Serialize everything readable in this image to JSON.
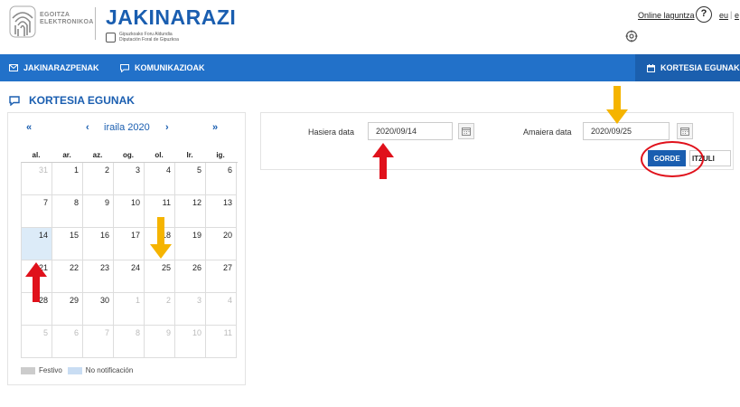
{
  "header": {
    "logo_line1": "EGOITZA",
    "logo_line2": "ELEKTRONIKOA",
    "app_title": "JAKINARAZI",
    "gip_line1": "Gipuzkoako Foru Aldundia",
    "gip_line2": "Diputación Foral de Gipuzkoa",
    "help_link": "Online laguntza",
    "help_icon_label": "?",
    "lang_eu": "eu",
    "lang_sep": "|",
    "lang_es": "e"
  },
  "nav": {
    "items": [
      {
        "label": "Jakinarazpenak",
        "icon": "envelope-icon"
      },
      {
        "label": "Komunikazioak",
        "icon": "comment-icon"
      },
      {
        "label": "Kortesia egunak",
        "icon": "calendar-icon"
      }
    ],
    "active_index": 2,
    "colors": {
      "bar": "#2271c9",
      "active": "#1b5fae"
    }
  },
  "section": {
    "title": "Kortesia egunak",
    "icon": "comment-icon"
  },
  "calendar": {
    "first_symbol": "«",
    "prev_symbol": "‹",
    "month_label": "iraila 2020",
    "next_symbol": "›",
    "last_symbol": "»",
    "weekdays": [
      "al.",
      "ar.",
      "az.",
      "og.",
      "ol.",
      "lr.",
      "ig."
    ],
    "weeks": [
      [
        {
          "d": "31",
          "o": true
        },
        {
          "d": "1"
        },
        {
          "d": "2"
        },
        {
          "d": "3"
        },
        {
          "d": "4"
        },
        {
          "d": "5"
        },
        {
          "d": "6"
        }
      ],
      [
        {
          "d": "7"
        },
        {
          "d": "8"
        },
        {
          "d": "9"
        },
        {
          "d": "10"
        },
        {
          "d": "11"
        },
        {
          "d": "12"
        },
        {
          "d": "13"
        }
      ],
      [
        {
          "d": "14",
          "t": true
        },
        {
          "d": "15"
        },
        {
          "d": "16"
        },
        {
          "d": "17"
        },
        {
          "d": "18"
        },
        {
          "d": "19"
        },
        {
          "d": "20"
        }
      ],
      [
        {
          "d": "21"
        },
        {
          "d": "22"
        },
        {
          "d": "23"
        },
        {
          "d": "24"
        },
        {
          "d": "25"
        },
        {
          "d": "26"
        },
        {
          "d": "27"
        }
      ],
      [
        {
          "d": "28"
        },
        {
          "d": "29"
        },
        {
          "d": "30"
        },
        {
          "d": "1",
          "o": true
        },
        {
          "d": "2",
          "o": true
        },
        {
          "d": "3",
          "o": true
        },
        {
          "d": "4",
          "o": true
        }
      ],
      [
        {
          "d": "5",
          "o": true
        },
        {
          "d": "6",
          "o": true
        },
        {
          "d": "7",
          "o": true
        },
        {
          "d": "8",
          "o": true
        },
        {
          "d": "9",
          "o": true
        },
        {
          "d": "10",
          "o": true
        },
        {
          "d": "11",
          "o": true
        }
      ]
    ],
    "legend": {
      "festivo": "Festivo",
      "no_notif": "No notificación"
    }
  },
  "form": {
    "start_label": "Hasiera data",
    "start_value": "2020/09/14",
    "end_label": "Amaiera data",
    "end_value": "2020/09/25",
    "save_label": "Gorde",
    "back_label": "Itzuli"
  },
  "annotations": {
    "red": "#e0111b",
    "yellow": "#f5b400"
  }
}
